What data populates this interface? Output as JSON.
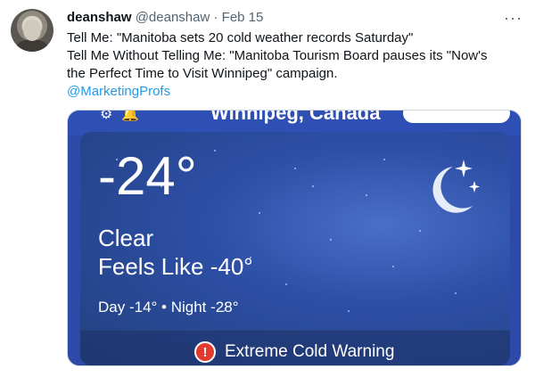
{
  "tweet": {
    "name": "deanshaw",
    "handle": "@deanshaw",
    "separator": "·",
    "date": "Feb 15",
    "more": "···",
    "lines": [
      "Tell Me: \"Manitoba sets 20 cold weather records Saturday\"",
      "Tell Me Without Telling Me: \"Manitoba Tourism Board pauses its \"Now's",
      "the Perfect Time to Visit Winnipeg\" campaign."
    ],
    "mention": "@MarketingProfs"
  },
  "weather": {
    "location": "Winnipeg, Canada",
    "temperature": "-24°",
    "condition": "Clear",
    "feels_like": "Feels Like -40°",
    "day_night": "Day -14° • Night -28°",
    "warning_icon": "!",
    "warning": "Extreme Cold Warning",
    "icons": [
      "gear-icon",
      "bell-icon",
      "moon-stars-icon",
      "alert-icon"
    ]
  }
}
